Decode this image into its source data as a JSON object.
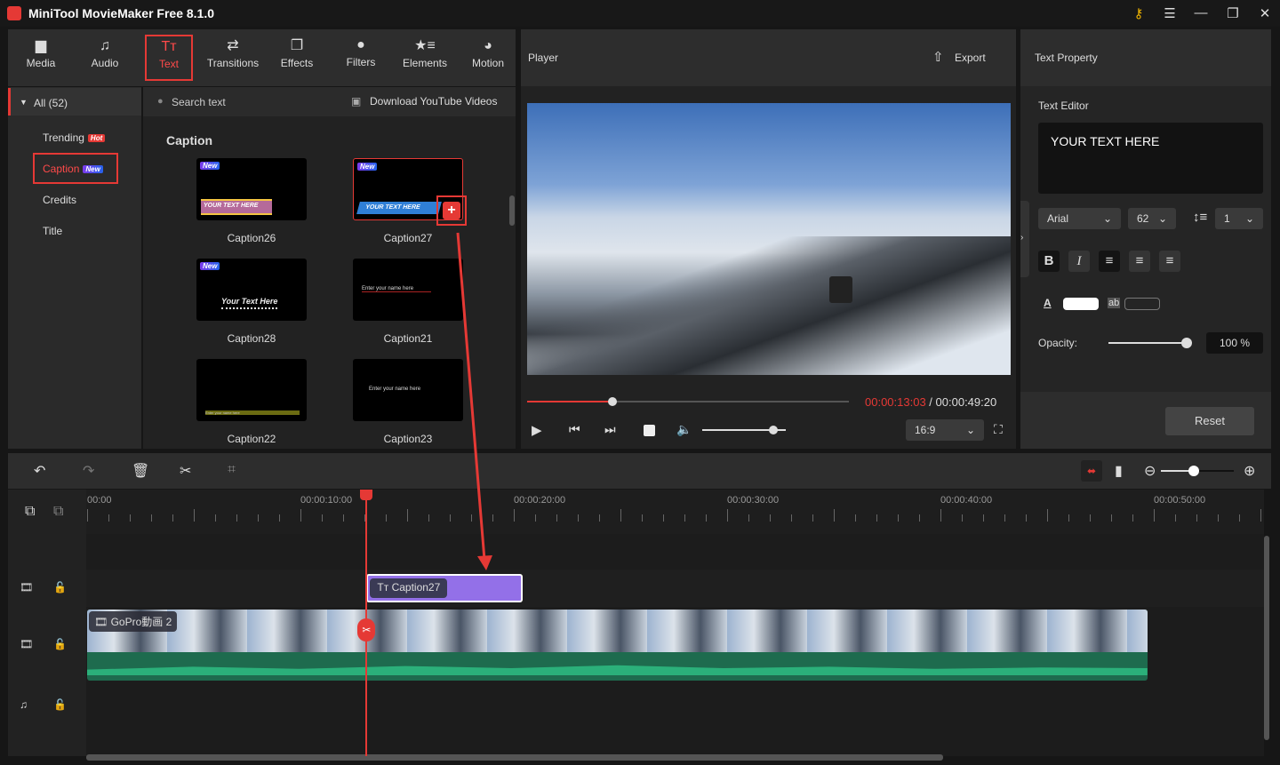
{
  "app": {
    "title": "MiniTool MovieMaker Free 8.1.0"
  },
  "window_controls": [
    "key-icon",
    "menu-icon",
    "minimize-icon",
    "maximize-icon",
    "close-icon"
  ],
  "toolbar": {
    "items": [
      {
        "label": "Media",
        "icon": "folder-icon"
      },
      {
        "label": "Audio",
        "icon": "music-icon"
      },
      {
        "label": "Text",
        "icon": "text-icon",
        "active": true
      },
      {
        "label": "Transitions",
        "icon": "transitions-icon"
      },
      {
        "label": "Effects",
        "icon": "effects-icon"
      },
      {
        "label": "Filters",
        "icon": "filters-icon"
      },
      {
        "label": "Elements",
        "icon": "elements-icon"
      },
      {
        "label": "Motion",
        "icon": "motion-icon"
      }
    ]
  },
  "library": {
    "all_label": "All (52)",
    "categories": [
      {
        "label": "Trending",
        "badge": "Hot"
      },
      {
        "label": "Caption",
        "badge": "New",
        "active": true
      },
      {
        "label": "Credits"
      },
      {
        "label": "Title"
      }
    ],
    "search_placeholder": "Search text",
    "download_label": "Download YouTube Videos",
    "section_title": "Caption",
    "items": [
      {
        "name": "Caption26",
        "badge": "New",
        "preview_text": "YOUR TEXT HERE"
      },
      {
        "name": "Caption27",
        "badge": "New",
        "preview_text": "YOUR TEXT HERE",
        "selected": true
      },
      {
        "name": "Caption28",
        "badge": "New",
        "preview_text": "Your Text Here"
      },
      {
        "name": "Caption21",
        "preview_text": "Enter your name here"
      },
      {
        "name": "Caption22",
        "preview_text": "Enter your name here"
      },
      {
        "name": "Caption23",
        "preview_text": "Enter your name here"
      }
    ]
  },
  "player": {
    "title": "Player",
    "export_label": "Export",
    "current_time": "00:00:13:03",
    "separator": " / ",
    "total_time": "00:00:49:20",
    "progress": 0.265,
    "volume": 0.8,
    "aspect_ratio": "16:9"
  },
  "text_property": {
    "title": "Text Property",
    "editor_label": "Text Editor",
    "text": "YOUR TEXT HERE",
    "font": "Arial",
    "size": "62",
    "line_spacing": "1",
    "text_color": "#ffffff",
    "opacity_label": "Opacity:",
    "opacity": "100 %",
    "opacity_value": 1.0,
    "reset_label": "Reset"
  },
  "timeline": {
    "ruler_labels": [
      "00:00",
      "00:00:10:00",
      "00:00:20:00",
      "00:00:30:00",
      "00:00:40:00",
      "00:00:50:00"
    ],
    "playhead_seconds": 13.1,
    "zoom": 0.45,
    "text_clip": {
      "label": "Caption27",
      "start": 13.1,
      "end": 20.4,
      "color": "#9370e8"
    },
    "video_clip": {
      "label": "GoPro動画 2",
      "start": 0,
      "end": 49.7
    },
    "accent": "#e53935"
  }
}
